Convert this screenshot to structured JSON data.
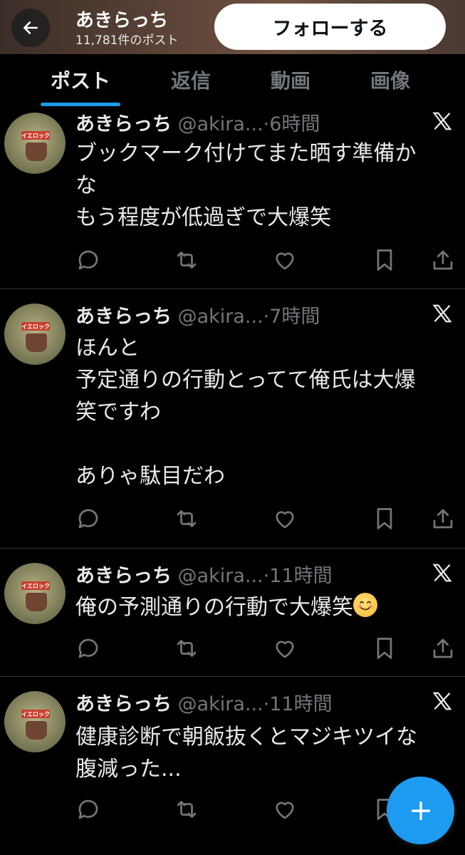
{
  "header": {
    "name": "あきらっち",
    "post_count": "11,781件のポスト",
    "follow_label": "フォローする"
  },
  "tabs": [
    {
      "label": "ポスト",
      "active": true
    },
    {
      "label": "返信",
      "active": false
    },
    {
      "label": "動画",
      "active": false
    },
    {
      "label": "画像",
      "active": false
    }
  ],
  "avatar_logo_text": "イエロック",
  "tweets": [
    {
      "name": "あきらっち",
      "handle": "@akira...",
      "time": "·6時間",
      "text": "ブックマーク付けてまた晒す準備か\nな\nもう程度が低過ぎで大爆笑"
    },
    {
      "name": "あきらっち",
      "handle": "@akira...",
      "time": "·7時間",
      "text": "ほんと\n予定通りの行動とってて俺氏は大爆\n笑ですわ\n\nありゃ駄目だわ"
    },
    {
      "name": "あきらっち",
      "handle": "@akira...",
      "time": "·11時間",
      "text": "俺の予測通りの行動で大爆笑",
      "emoji": "smiling-face-emoji"
    },
    {
      "name": "あきらっち",
      "handle": "@akira...",
      "time": "·11時間",
      "text": "健康診断で朝飯抜くとマジキツイな\n腹減った..."
    }
  ],
  "icons": {
    "back": "arrow-left-icon",
    "reply": "speech-bubble-icon",
    "repost": "repost-arrows-icon",
    "like": "heart-icon",
    "bookmark": "bookmark-icon",
    "share": "share-upload-icon",
    "source": "x-logo-icon",
    "compose": "plus-icon"
  },
  "colors": {
    "accent": "#1d9bf0",
    "background": "#000000",
    "text": "#e7e9ea",
    "secondary": "#71767b",
    "divider": "#2f3336"
  }
}
